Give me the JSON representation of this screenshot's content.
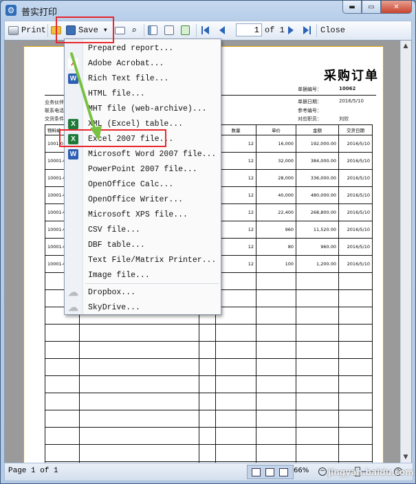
{
  "window": {
    "title": "普实打印",
    "buttons": {
      "minimize": "▬",
      "maximize": "▭",
      "close": "✕"
    }
  },
  "toolbar": {
    "print_label": "Print",
    "save_label": "Save",
    "page_value": "1",
    "page_of": "of 1",
    "close_label": "Close"
  },
  "save_menu": {
    "items": [
      {
        "label": "Prepared report...",
        "icon": ""
      },
      {
        "label": "Adobe Acrobat...",
        "icon": "pdf-icon"
      },
      {
        "label": "Rich Text file...",
        "icon": "word-icon"
      },
      {
        "label": "HTML file...",
        "icon": ""
      },
      {
        "label": "MHT file (web-archive)...",
        "icon": ""
      },
      {
        "label": "XML (Excel) table...",
        "icon": "excel-icon"
      },
      {
        "label": "Excel 2007 file...",
        "icon": "excel-icon"
      },
      {
        "label": "Microsoft Word 2007 file...",
        "icon": "word-icon"
      },
      {
        "label": "PowerPoint 2007 file...",
        "icon": ""
      },
      {
        "label": "OpenOffice Calc...",
        "icon": ""
      },
      {
        "label": "OpenOffice Writer...",
        "icon": ""
      },
      {
        "label": "Microsoft XPS file...",
        "icon": ""
      },
      {
        "label": "CSV file...",
        "icon": ""
      },
      {
        "label": "DBF table...",
        "icon": ""
      },
      {
        "label": "Text File/Matrix Printer...",
        "icon": ""
      },
      {
        "label": "Image file...",
        "icon": ""
      },
      {
        "label": "Dropbox...",
        "icon": "cloud-icon"
      },
      {
        "label": "SkyDrive...",
        "icon": "cloud-icon"
      }
    ]
  },
  "report": {
    "title": "采购订单",
    "meta": [
      {
        "label": "单据编号：",
        "value": "10062"
      },
      {
        "label": "单据日期：",
        "value": "2016/5/10"
      },
      {
        "label": "参考编号：",
        "value": ""
      },
      {
        "label": "对应职员：",
        "value": "刘欣"
      }
    ],
    "left_labels": [
      "业务伙伴",
      "联系电话",
      "交货条件"
    ],
    "headers": [
      "物料编",
      "数量",
      "单价",
      "金额",
      "交货日期"
    ],
    "rows": [
      {
        "code": "1001-0",
        "qty": "12",
        "price": "16,000",
        "amount": "192,000.00",
        "date": "2016/5/10"
      },
      {
        "code": "10001-0",
        "qty": "12",
        "price": "32,000",
        "amount": "384,000.00",
        "date": "2016/5/10"
      },
      {
        "code": "10001-0",
        "qty": "12",
        "price": "28,000",
        "amount": "336,000.00",
        "date": "2016/5/10"
      },
      {
        "code": "10001-0",
        "qty": "12",
        "price": "40,000",
        "amount": "480,000.00",
        "date": "2016/5/10"
      },
      {
        "code": "10001-0",
        "qty": "12",
        "price": "22,400",
        "amount": "268,800.00",
        "date": "2016/5/10"
      },
      {
        "code": "10001-0",
        "qty": "12",
        "price": "960",
        "amount": "11,520.00",
        "date": "2016/5/10"
      },
      {
        "code": "10001-0",
        "qty": "12",
        "price": "80",
        "amount": "960.00",
        "date": "2016/5/10"
      },
      {
        "code": "10001-0",
        "qty": "12",
        "price": "100",
        "amount": "1,200.00",
        "date": "2016/5/10"
      }
    ],
    "empty_rows": 12
  },
  "status": {
    "page_text": "Page 1 of 1",
    "zoom": "66%",
    "watermark": "jingyan.baidu.com"
  },
  "colors": {
    "highlight_red": "#e8252a",
    "arrow_green": "#7ac143",
    "page_border": "#e0a000"
  }
}
